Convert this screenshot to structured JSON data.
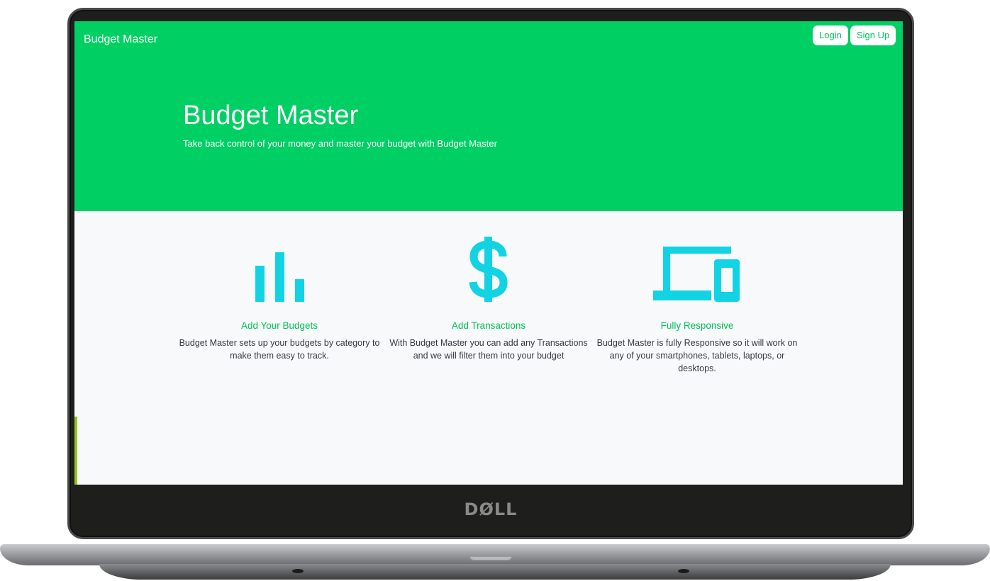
{
  "device": {
    "logo": "DØLL"
  },
  "navbar": {
    "brand": "Budget Master",
    "login_label": "Login",
    "signup_label": "Sign Up"
  },
  "hero": {
    "title": "Budget Master",
    "subtitle": "Take back control of your money and master your budget with Budget Master"
  },
  "features": [
    {
      "icon": "bar-chart-icon",
      "title": "Add Your Budgets",
      "description": "Budget Master sets up your budgets by category to make them easy to track."
    },
    {
      "icon": "dollar-sign-icon",
      "title": "Add Transactions",
      "description": "With Budget Master you can add any Transactions and we will filter them into your budget"
    },
    {
      "icon": "devices-icon",
      "title": "Fully Responsive",
      "description": "Budget Master is fully Responsive so it will work on any of your smartphones, tablets, laptops, or desktops."
    }
  ],
  "colors": {
    "brand_green": "#00d063",
    "accent_green": "#00c25a",
    "icon_cyan": "#12d3e3",
    "page_bg": "#f8f9fb"
  }
}
